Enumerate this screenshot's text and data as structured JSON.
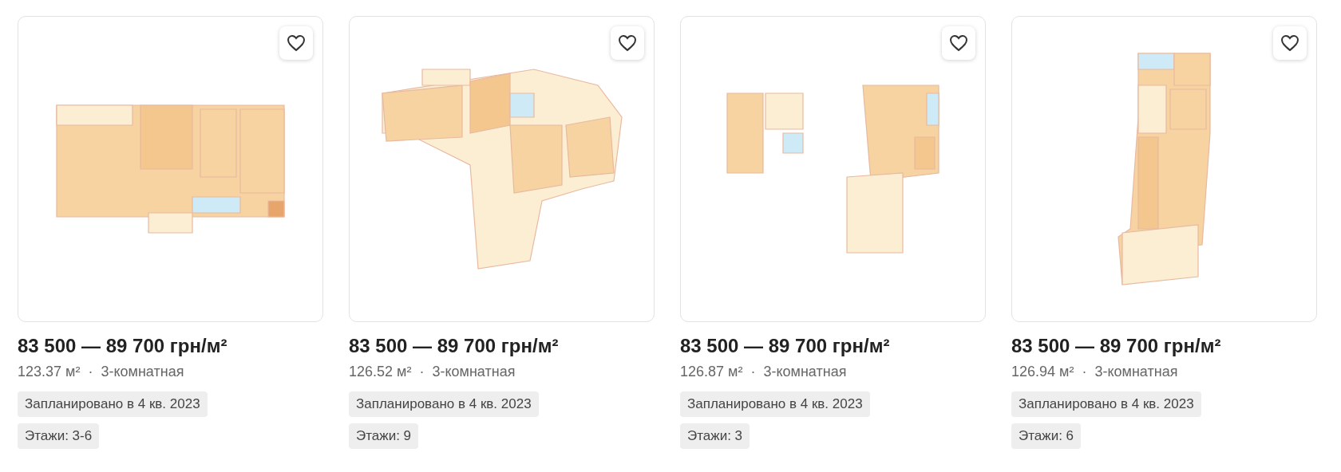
{
  "cards": [
    {
      "favorite": false,
      "price": "83 500 — 89 700 грн/м²",
      "area": "123.37 м²",
      "separator": "·",
      "rooms": "3-комнатная",
      "tags": [
        "Запланировано в 4 кв. 2023",
        "Этажи: 3-6"
      ]
    },
    {
      "favorite": false,
      "price": "83 500 — 89 700 грн/м²",
      "area": "126.52 м²",
      "separator": "·",
      "rooms": "3-комнатная",
      "tags": [
        "Запланировано в 4 кв. 2023",
        "Этажи: 9"
      ]
    },
    {
      "favorite": false,
      "price": "83 500 — 89 700 грн/м²",
      "area": "126.87 м²",
      "separator": "·",
      "rooms": "3-комнатная",
      "tags": [
        "Запланировано в 4 кв. 2023",
        "Этажи: 3"
      ]
    },
    {
      "favorite": false,
      "price": "83 500 — 89 700 грн/м²",
      "area": "126.94 м²",
      "separator": "·",
      "rooms": "3-комнатная",
      "tags": [
        "Запланировано в 4 кв. 2023",
        "Этажи: 6"
      ]
    }
  ]
}
